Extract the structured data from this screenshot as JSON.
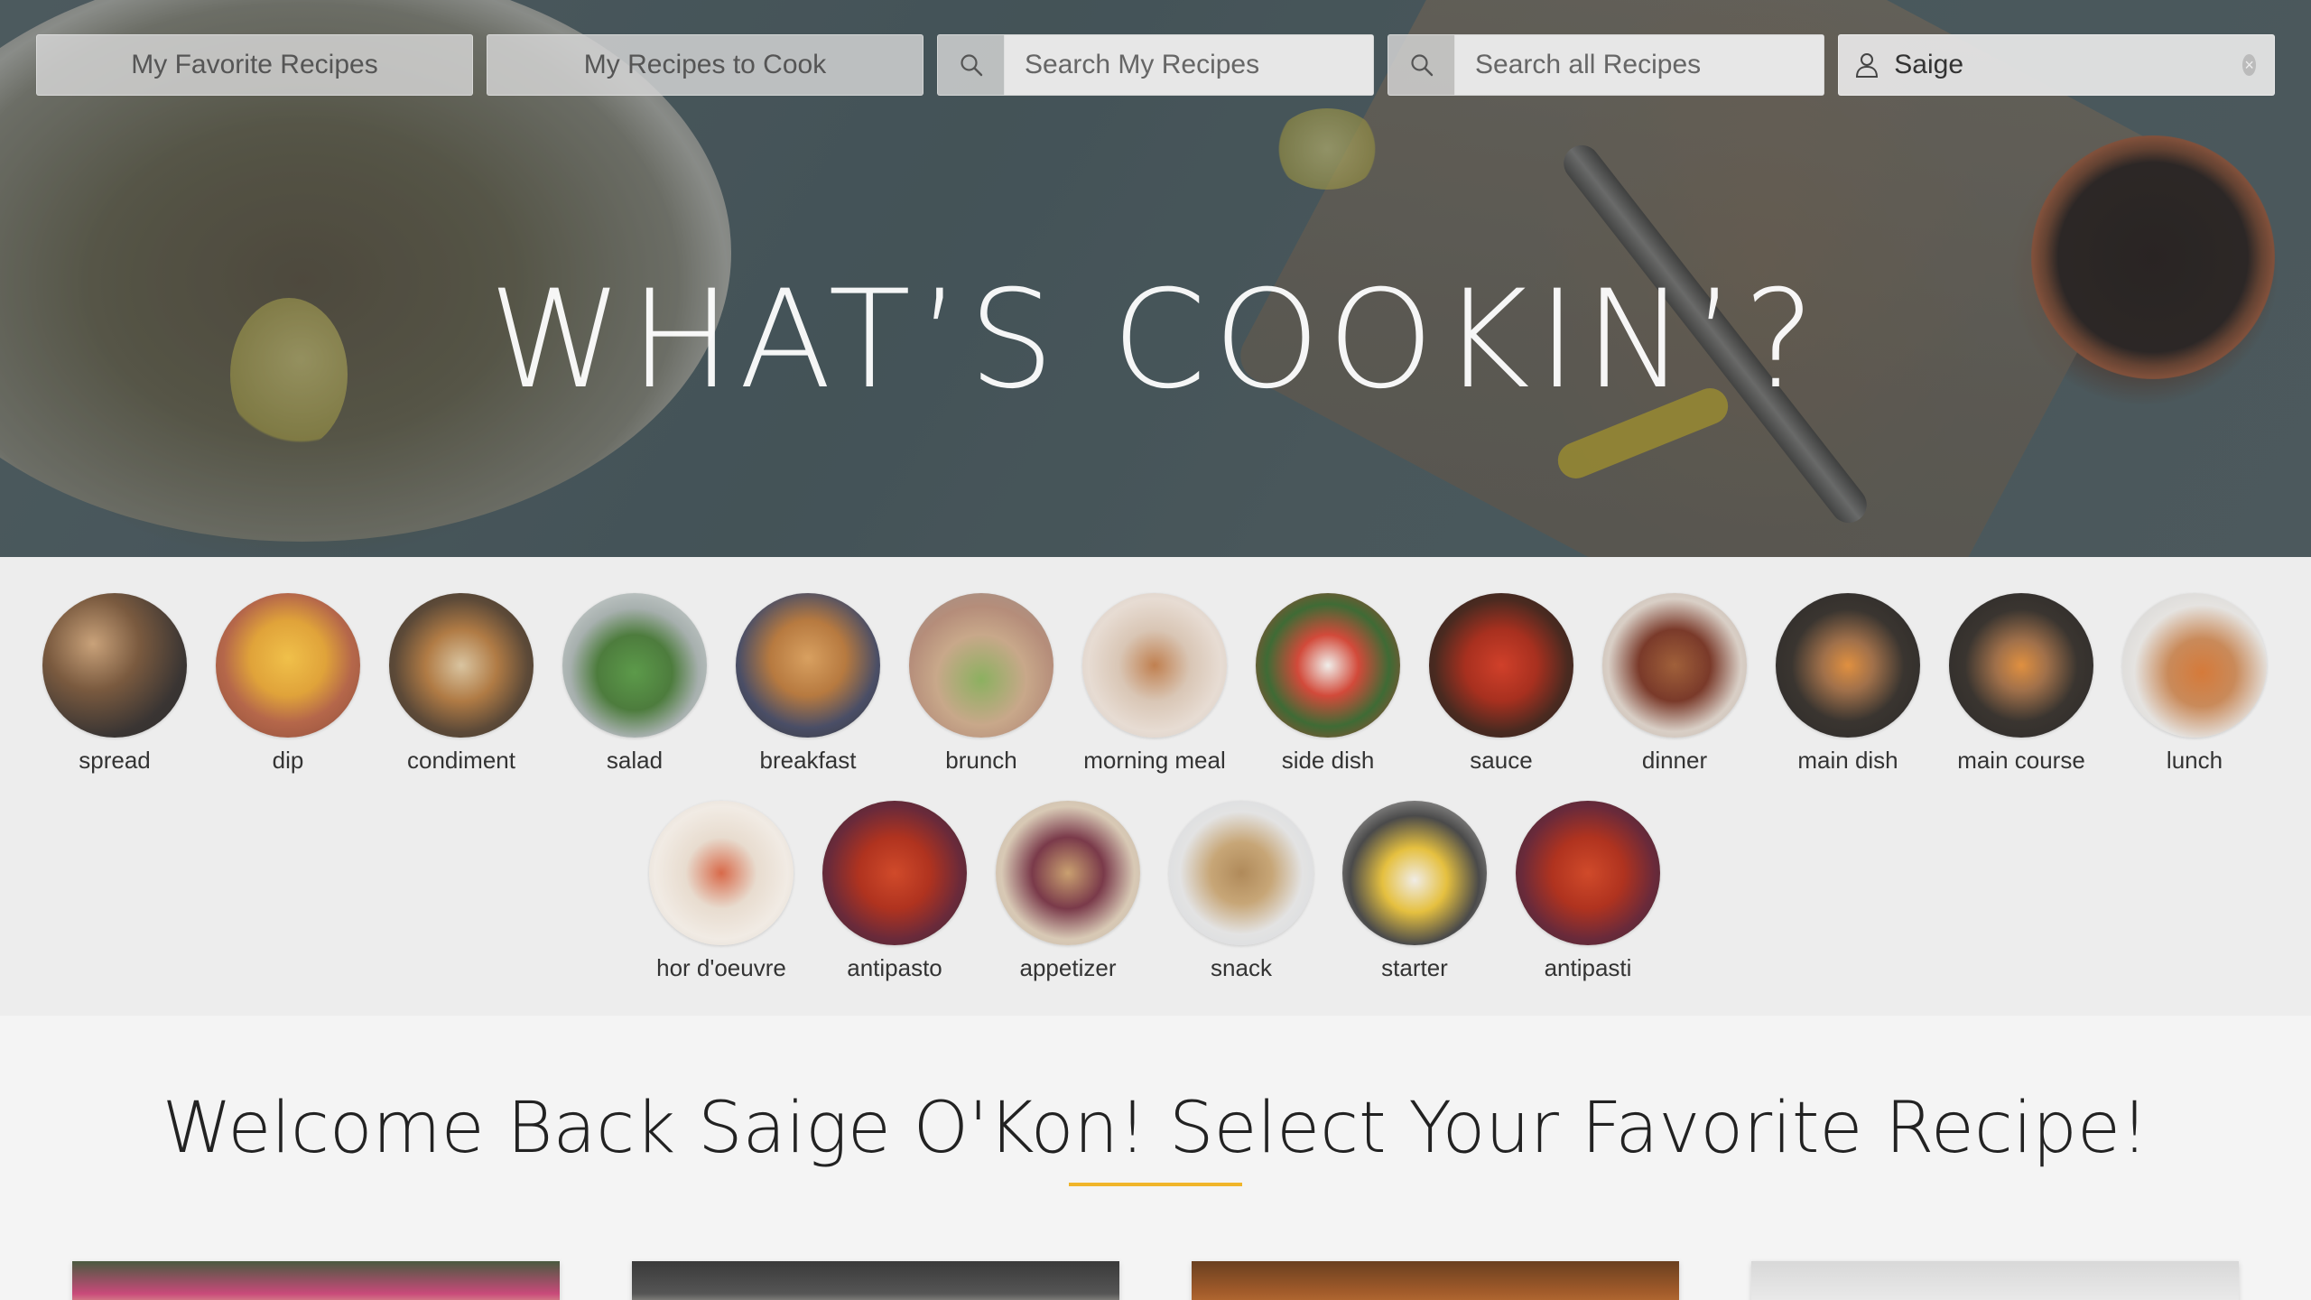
{
  "nav": {
    "favorites_label": "My Favorite Recipes",
    "to_cook_label": "My Recipes to Cook",
    "search_my_placeholder": "Search My Recipes",
    "search_all_placeholder": "Search all Recipes",
    "user_value": "Saige"
  },
  "hero": {
    "title": "WHAT’S COOKIN’?"
  },
  "categories": [
    {
      "label": "spread"
    },
    {
      "label": "dip"
    },
    {
      "label": "condiment"
    },
    {
      "label": "salad"
    },
    {
      "label": "breakfast"
    },
    {
      "label": "brunch"
    },
    {
      "label": "morning meal"
    },
    {
      "label": "side dish"
    },
    {
      "label": "sauce"
    },
    {
      "label": "dinner"
    },
    {
      "label": "main dish"
    },
    {
      "label": "main course"
    },
    {
      "label": "lunch"
    },
    {
      "label": "hor d'oeuvre"
    },
    {
      "label": "antipasto"
    },
    {
      "label": "appetizer"
    },
    {
      "label": "snack"
    },
    {
      "label": "starter"
    },
    {
      "label": "antipasti"
    }
  ],
  "welcome": {
    "heading": "Welcome Back Saige O'Kon! Select Your Favorite Recipe!"
  },
  "colors": {
    "accent_rule": "#f0b52a",
    "nav_bg": "#d7d7d7",
    "strip_bg": "#ededed",
    "page_bg": "#f4f4f4"
  }
}
